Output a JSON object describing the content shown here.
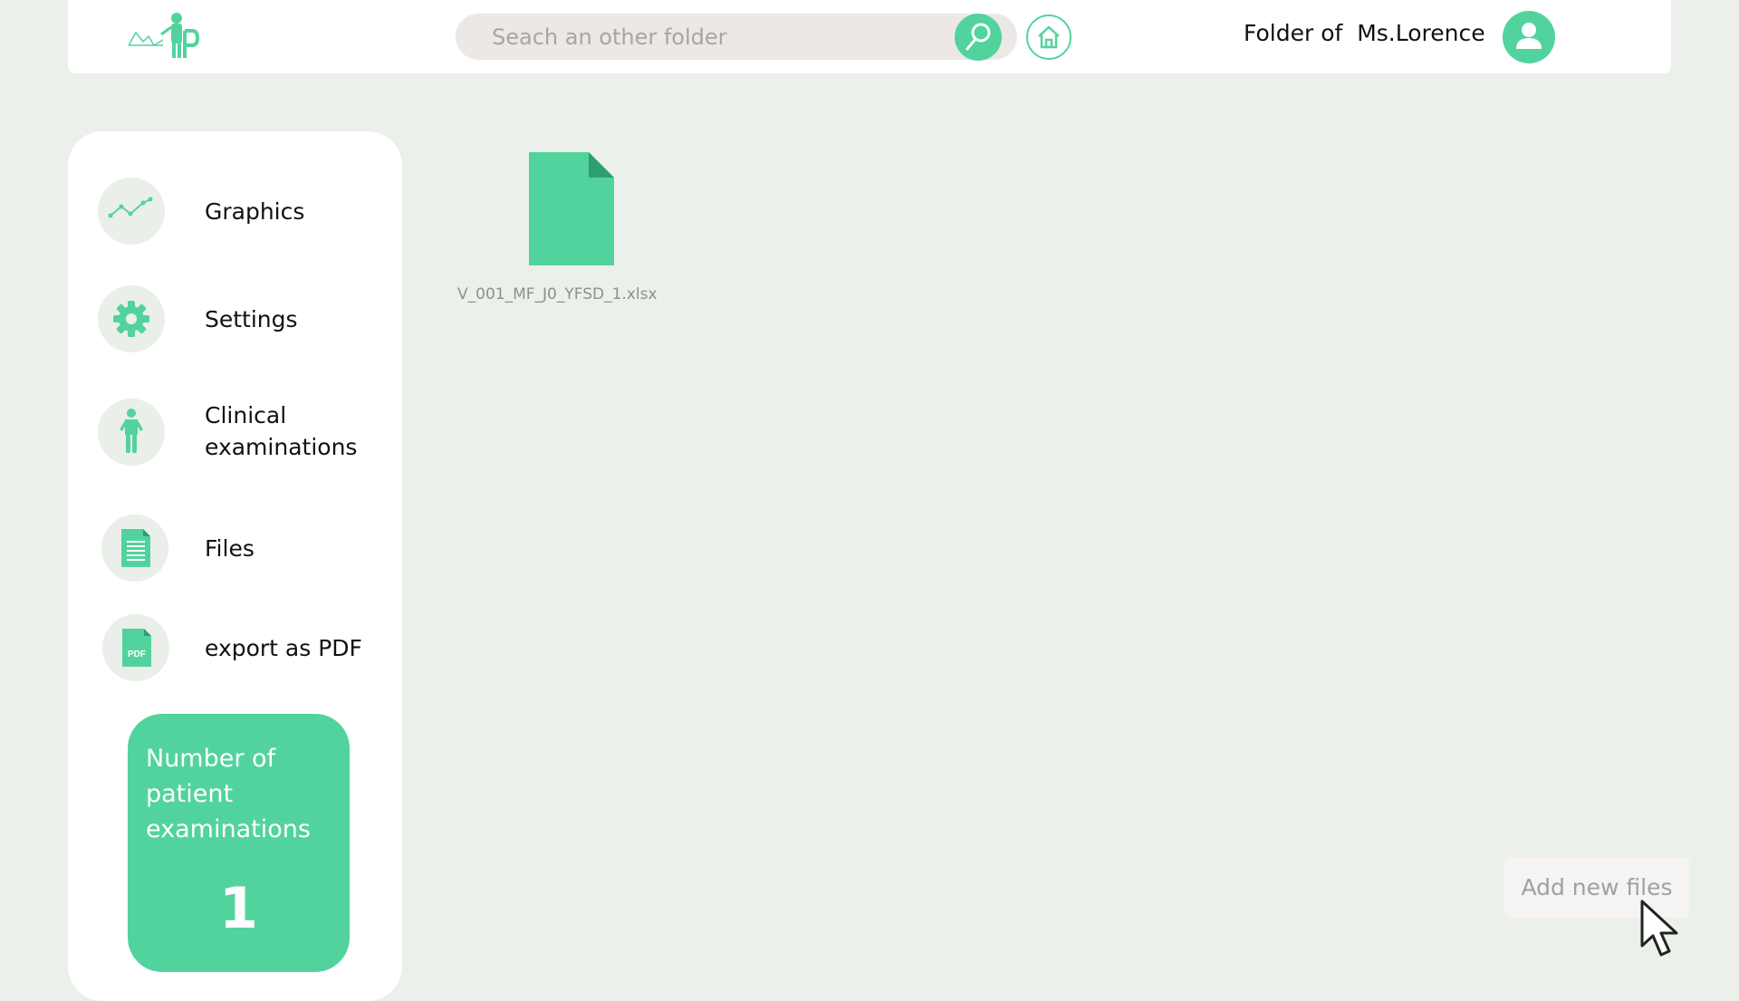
{
  "header": {
    "search_placeholder": "Seach an other folder",
    "folder_title": "Folder of  Ms.Lorence",
    "icons": {
      "logo": "app-logo",
      "search": "magnifier-icon",
      "home": "home-icon",
      "avatar": "user-icon"
    }
  },
  "sidebar": {
    "items": [
      {
        "label": "Graphics",
        "icon": "line-chart-icon"
      },
      {
        "label": "Settings",
        "icon": "gear-icon"
      },
      {
        "label": "Clinical examinations",
        "icon": "person-icon"
      },
      {
        "label": "Files",
        "icon": "document-icon"
      },
      {
        "label": "export as PDF",
        "icon": "pdf-icon"
      }
    ],
    "counter": {
      "label": "Number of patient examinations",
      "value": "1"
    }
  },
  "files": [
    {
      "name": "V_001_MF_J0_YFSD_1.xlsx",
      "icon": "file-icon"
    }
  ],
  "actions": {
    "add_files_label": "Add new files"
  },
  "colors": {
    "accent": "#52d39d",
    "accent_dark": "#2f9e6e",
    "background": "#ebf0ea",
    "panel": "#ffffff"
  }
}
